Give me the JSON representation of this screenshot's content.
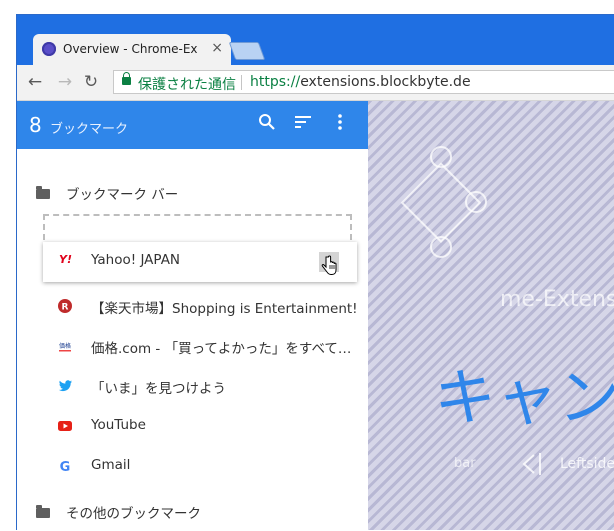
{
  "browser": {
    "tab_title": "Overview - Chrome-Ex",
    "tab_close": "×",
    "back": "←",
    "forward": "→",
    "reload": "↻",
    "security_label": "保護された通信",
    "url_scheme": "https://",
    "url_host": "extensions.blockbyte.de"
  },
  "panel": {
    "count": "8",
    "title": "ブックマーク",
    "icons": [
      "search-icon",
      "sort-icon",
      "more-vert-icon"
    ],
    "folders": [
      {
        "label": "ブックマーク バー"
      },
      {
        "label": "その他のブックマーク"
      }
    ],
    "dragging_item": {
      "label": "Yahoo! JAPAN",
      "icon_text": "Y!"
    },
    "bookmarks": [
      {
        "label": "【楽天市場】Shopping is Entertainment!",
        "icon": "rakuten-icon",
        "icon_text": "R"
      },
      {
        "label": "価格.com - 「買ってよかった」をすべてのひとに。",
        "icon": "kakaku-icon",
        "icon_text": "価格"
      },
      {
        "label": "「いま」を見つけよう",
        "icon": "twitter-icon"
      },
      {
        "label": "YouTube",
        "icon": "youtube-icon"
      },
      {
        "label": "Gmail",
        "icon": "google-icon",
        "icon_text": "G"
      }
    ]
  },
  "background_page": {
    "subtitle": "me-Extensions",
    "headline": "キャン",
    "left_text": "bar",
    "right_text": "Leftside"
  },
  "colors": {
    "accent": "#2f86ea",
    "tabstrip": "#1f6fe2",
    "secure": "#0b8043"
  }
}
